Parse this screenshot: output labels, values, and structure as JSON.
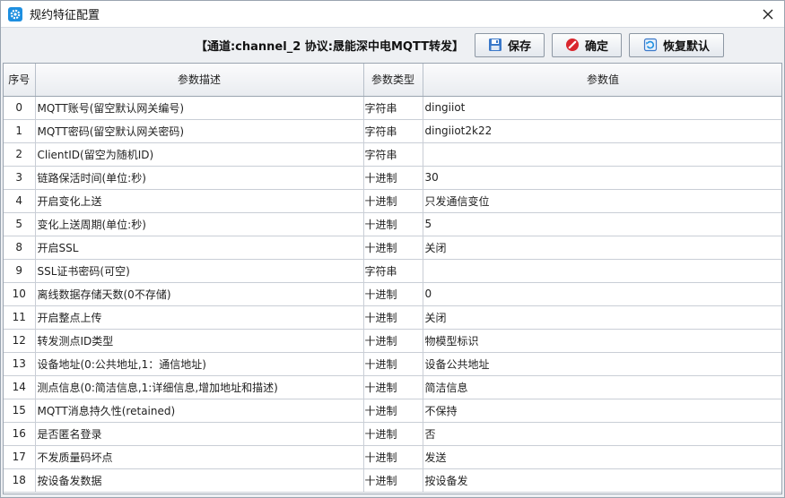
{
  "window": {
    "title": "规约特征配置"
  },
  "toolbar": {
    "channel_title": "【通道:channel_2  协议:晟能深中电MQTT转发】",
    "save_label": "保存",
    "ok_label": "确定",
    "reset_label": "恢复默认"
  },
  "table": {
    "headers": [
      "序号",
      "参数描述",
      "参数类型",
      "参数值"
    ],
    "rows": [
      {
        "idx": "0",
        "desc": "MQTT账号(留空默认网关编号)",
        "type": "字符串",
        "value": "dingiiot"
      },
      {
        "idx": "1",
        "desc": "MQTT密码(留空默认网关密码)",
        "type": "字符串",
        "value": "dingiiot2k22"
      },
      {
        "idx": "2",
        "desc": "ClientID(留空为随机ID)",
        "type": "字符串",
        "value": ""
      },
      {
        "idx": "3",
        "desc": "链路保活时间(单位:秒)",
        "type": "十进制",
        "value": "30"
      },
      {
        "idx": "4",
        "desc": "开启变化上送",
        "type": "十进制",
        "value": "只发通信变位"
      },
      {
        "idx": "5",
        "desc": "变化上送周期(单位:秒)",
        "type": "十进制",
        "value": "5"
      },
      {
        "idx": "8",
        "desc": "开启SSL",
        "type": "十进制",
        "value": "关闭"
      },
      {
        "idx": "9",
        "desc": "SSL证书密码(可空)",
        "type": "字符串",
        "value": ""
      },
      {
        "idx": "10",
        "desc": "离线数据存储天数(0不存储)",
        "type": "十进制",
        "value": "0"
      },
      {
        "idx": "11",
        "desc": "开启整点上传",
        "type": "十进制",
        "value": "关闭"
      },
      {
        "idx": "12",
        "desc": "转发测点ID类型",
        "type": "十进制",
        "value": "物模型标识"
      },
      {
        "idx": "13",
        "desc": "设备地址(0:公共地址,1：通信地址)",
        "type": "十进制",
        "value": "设备公共地址"
      },
      {
        "idx": "14",
        "desc": "测点信息(0:简洁信息,1:详细信息,增加地址和描述)",
        "type": "十进制",
        "value": "简洁信息"
      },
      {
        "idx": "15",
        "desc": "MQTT消息持久性(retained)",
        "type": "十进制",
        "value": "不保持"
      },
      {
        "idx": "16",
        "desc": "是否匿名登录",
        "type": "十进制",
        "value": "否"
      },
      {
        "idx": "17",
        "desc": "不发质量码坏点",
        "type": "十进制",
        "value": "发送"
      },
      {
        "idx": "18",
        "desc": "按设备发数据",
        "type": "十进制",
        "value": "按设备发"
      }
    ]
  },
  "icons": {
    "app": "gear-icon",
    "close": "close-icon",
    "save": "floppy-disk-icon",
    "ok": "no-entry-icon",
    "reset": "restore-icon"
  },
  "colors": {
    "accent": "#1e8fe0",
    "ok_red": "#d9272e"
  }
}
